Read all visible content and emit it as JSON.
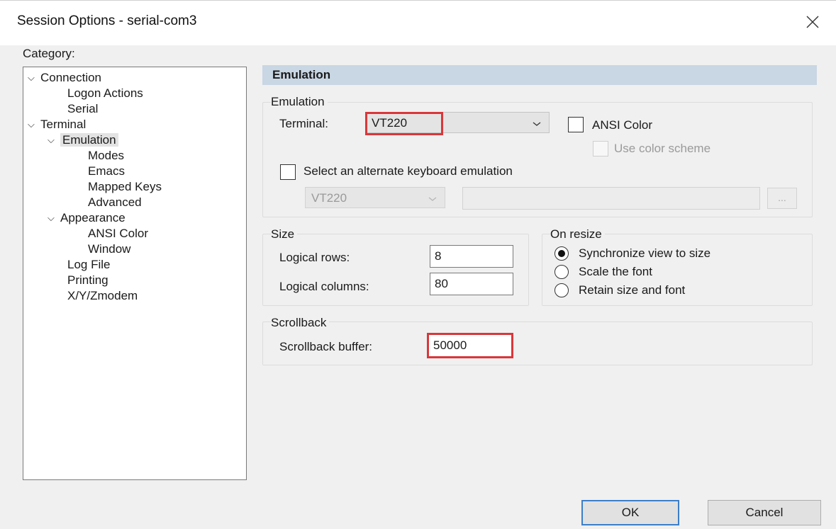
{
  "window": {
    "title": "Session Options - serial-com3",
    "close_icon": "close-icon"
  },
  "category": {
    "label": "Category:",
    "items": [
      {
        "label": "Connection",
        "expanded": true
      },
      {
        "label": "Logon Actions"
      },
      {
        "label": "Serial"
      },
      {
        "label": "Terminal",
        "expanded": true
      },
      {
        "label": "Emulation",
        "expanded": true,
        "selected": true
      },
      {
        "label": "Modes"
      },
      {
        "label": "Emacs"
      },
      {
        "label": "Mapped Keys"
      },
      {
        "label": "Advanced"
      },
      {
        "label": "Appearance",
        "expanded": true
      },
      {
        "label": "ANSI Color"
      },
      {
        "label": "Window"
      },
      {
        "label": "Log File"
      },
      {
        "label": "Printing"
      },
      {
        "label": "X/Y/Zmodem"
      }
    ]
  },
  "panel": {
    "header": "Emulation",
    "emulation_group": {
      "title": "Emulation",
      "terminal_label": "Terminal:",
      "terminal_value": "VT220",
      "ansi_color_label": "ANSI Color",
      "ansi_color_checked": false,
      "use_color_scheme_label": "Use color scheme",
      "use_color_scheme_checked": false,
      "alt_keyboard_label": "Select an alternate keyboard emulation",
      "alt_keyboard_checked": false,
      "alt_keyboard_value": "VT220",
      "alt_keyboard_path": "",
      "browse_label": "..."
    },
    "size_group": {
      "title": "Size",
      "rows_label": "Logical rows:",
      "rows_value": "8",
      "columns_label": "Logical columns:",
      "columns_value": "80"
    },
    "resize_group": {
      "title": "On resize",
      "options": [
        {
          "label": "Synchronize view to size",
          "checked": true
        },
        {
          "label": "Scale the font",
          "checked": false
        },
        {
          "label": "Retain size and font",
          "checked": false
        }
      ]
    },
    "scrollback_group": {
      "title": "Scrollback",
      "buffer_label": "Scrollback buffer:",
      "buffer_value": "50000"
    }
  },
  "buttons": {
    "ok": "OK",
    "cancel": "Cancel"
  },
  "colors": {
    "section_header": "#c9d6e3",
    "highlight_box": "#d9373a",
    "default_button_border": "#3c7ec9"
  }
}
